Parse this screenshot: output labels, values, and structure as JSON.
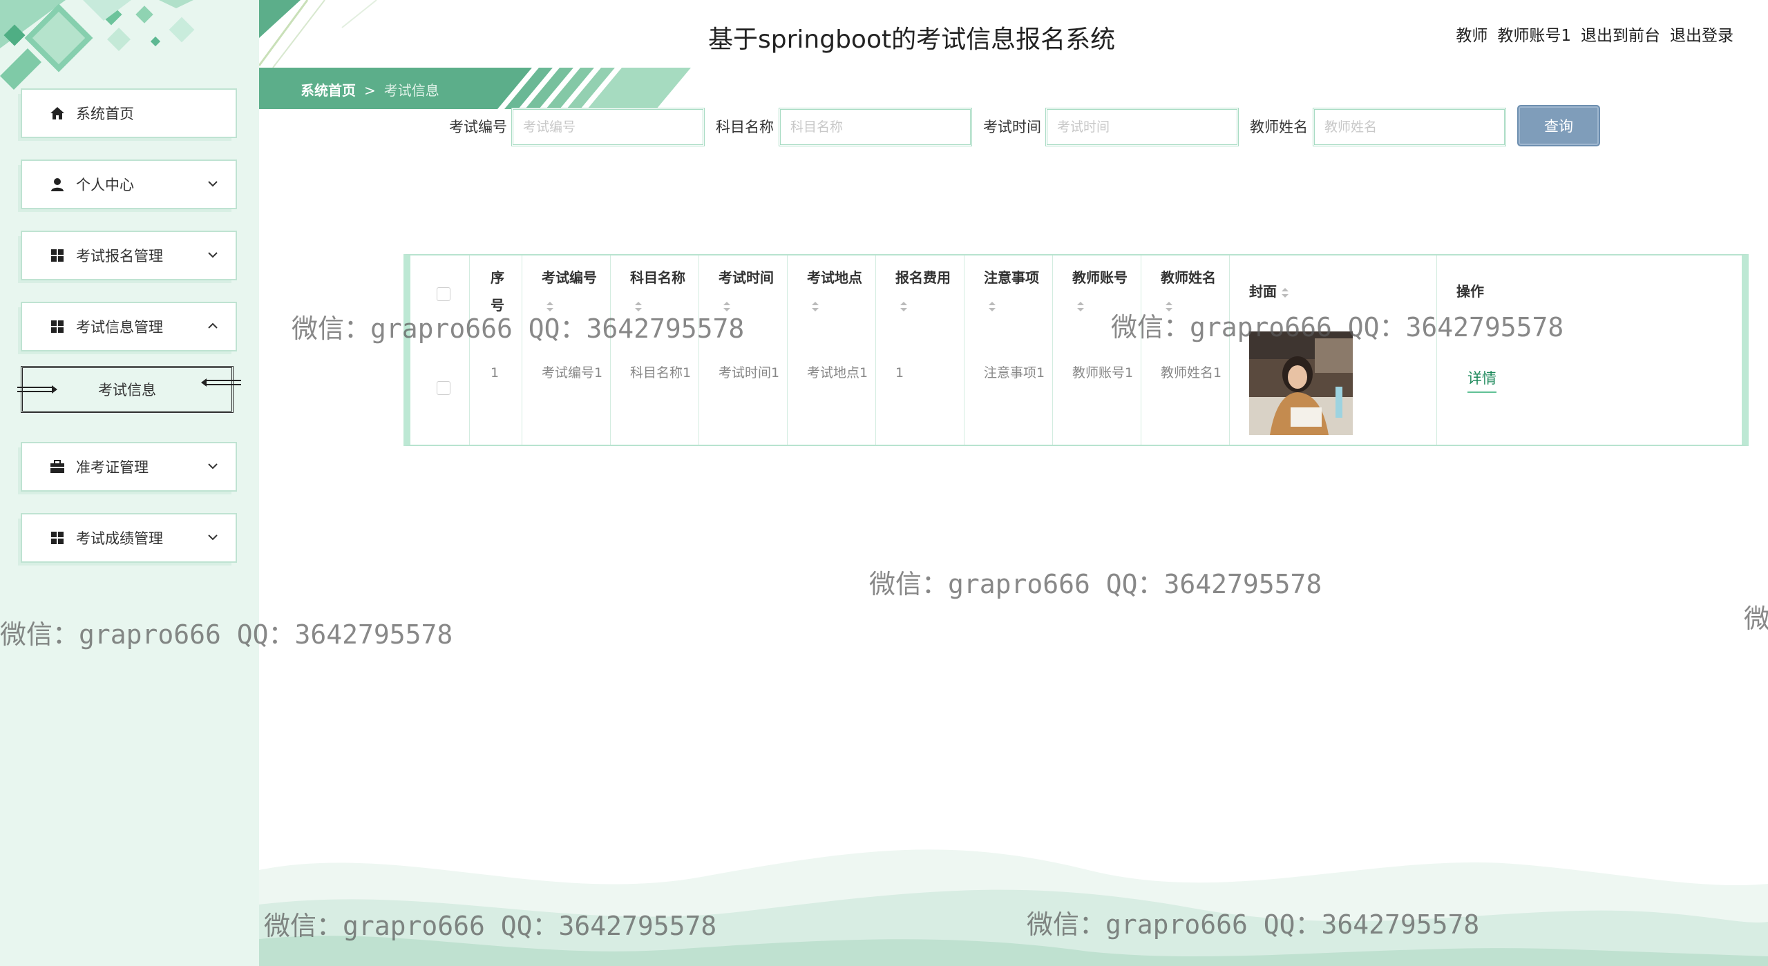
{
  "header": {
    "title": "基于springboot的考试信息报名系统",
    "user_role": "教师",
    "user_account": "教师账号1",
    "to_front": "退出到前台",
    "logout": "退出登录"
  },
  "sidebar": {
    "items": [
      {
        "label": "系统首页",
        "icon": "home-icon",
        "arrow": ""
      },
      {
        "label": "个人中心",
        "icon": "user-icon",
        "arrow": "down"
      },
      {
        "label": "考试报名管理",
        "icon": "grid-icon",
        "arrow": "down"
      },
      {
        "label": "考试信息管理",
        "icon": "grid-icon",
        "arrow": "up"
      },
      {
        "label": "准考证管理",
        "icon": "briefcase-icon",
        "arrow": "down"
      },
      {
        "label": "考试成绩管理",
        "icon": "grid-icon",
        "arrow": "down"
      }
    ],
    "subitem": "考试信息"
  },
  "breadcrumb": {
    "home": "系统首页",
    "separator": ">",
    "current": "考试信息"
  },
  "search": {
    "exam_no_label": "考试编号",
    "exam_no_placeholder": "考试编号",
    "subject_label": "科目名称",
    "subject_placeholder": "科目名称",
    "time_label": "考试时间",
    "time_placeholder": "考试时间",
    "teacher_label": "教师姓名",
    "teacher_placeholder": "教师姓名",
    "query_button": "查询"
  },
  "table": {
    "headers": {
      "index": "序号",
      "exam_no": "考试编号",
      "subject": "科目名称",
      "time": "考试时间",
      "place": "考试地点",
      "fee": "报名费用",
      "notes": "注意事项",
      "teacher_account": "教师账号",
      "teacher_name": "教师姓名",
      "cover": "封面",
      "action": "操作"
    },
    "rows": [
      {
        "index": "1",
        "exam_no": "考试编号1",
        "subject": "科目名称1",
        "time": "考试时间1",
        "place": "考试地点1",
        "fee": "1",
        "notes": "注意事项1",
        "teacher_account": "教师账号1",
        "teacher_name": "教师姓名1",
        "action": "详情"
      }
    ]
  },
  "watermark": "微信：grapro666 QQ：3642795578",
  "watermark_partial": "微",
  "colors": {
    "sidebar_bg": "#e8f6ef",
    "accent_green": "#5cae8a",
    "link_green": "#1f8a5c",
    "query_button": "#7f9dba"
  }
}
